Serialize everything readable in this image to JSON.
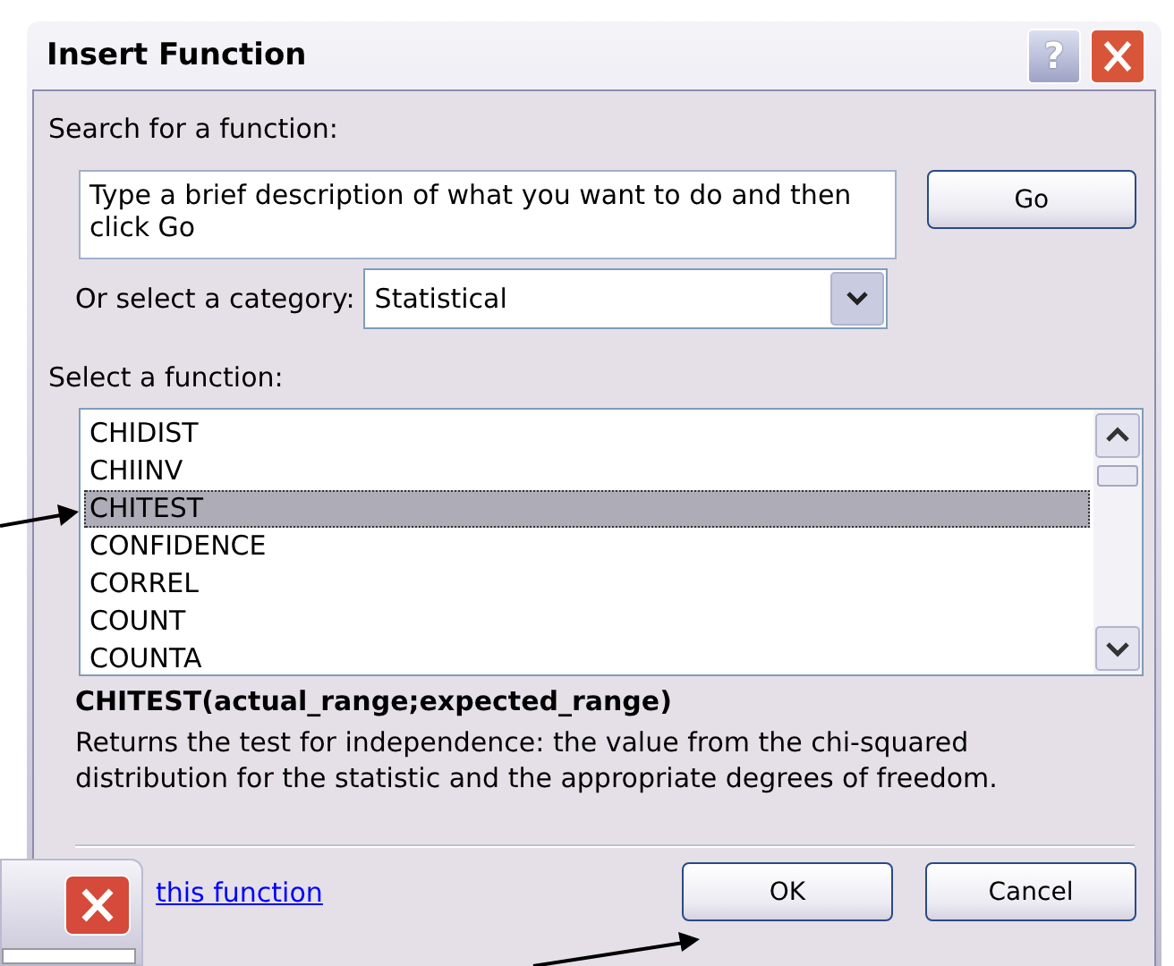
{
  "window": {
    "title": "Insert Function",
    "help_button": "?"
  },
  "search": {
    "label": "Search for a function:",
    "value": "Type a brief description of what you want to do and then click Go",
    "button": "Go"
  },
  "category": {
    "label": "Or select a category:",
    "value": "Statistical"
  },
  "functions": {
    "label": "Select a function:",
    "items": [
      {
        "name": "CHIDIST",
        "selected": false
      },
      {
        "name": "CHIINV",
        "selected": false
      },
      {
        "name": "CHITEST",
        "selected": true
      },
      {
        "name": "CONFIDENCE",
        "selected": false
      },
      {
        "name": "CORREL",
        "selected": false
      },
      {
        "name": "COUNT",
        "selected": false
      },
      {
        "name": "COUNTA",
        "selected": false
      }
    ]
  },
  "signature": "CHITEST(actual_range;expected_range)",
  "description": "Returns the test for independence: the value from the chi-squared distribution for the statistic and the appropriate degrees of freedom.",
  "help_link": "this function",
  "buttons": [
    "OK",
    "Cancel"
  ]
}
